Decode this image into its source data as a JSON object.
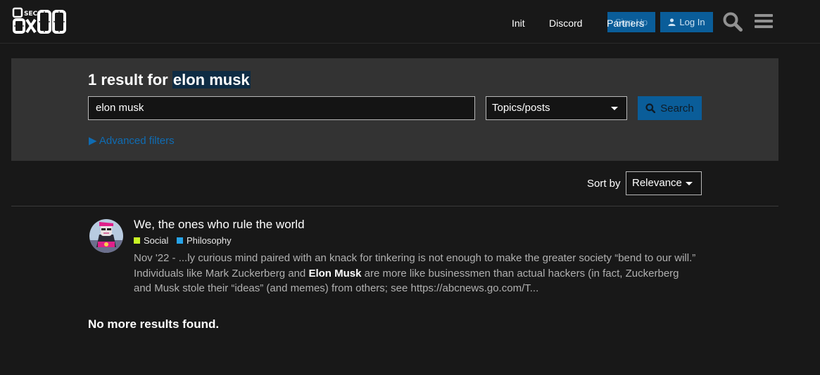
{
  "header": {
    "logo_text": "0x00 SEC",
    "nav": [
      {
        "label": "Init"
      },
      {
        "label": "Discord"
      },
      {
        "label": "Partners"
      }
    ],
    "signup_label": "Sign Up",
    "login_label": "Log In",
    "search_icon": "search-icon",
    "menu_icon": "hamburger-icon"
  },
  "search": {
    "count": "1",
    "heading_prefix": "result for",
    "term_display": "elon musk",
    "input_value": "elon musk",
    "type_selected": "Topics/posts",
    "search_button": "Search",
    "advanced_filters": "Advanced filters",
    "sort_label": "Sort by",
    "sort_selected": "Relevance"
  },
  "results": [
    {
      "title": "We, the ones who rule the world",
      "categories": [
        {
          "name": "Social",
          "color": "#c9f425"
        },
        {
          "name": "Philosophy",
          "color": "#27a3e8"
        }
      ],
      "blurb": {
        "line1": "Nov '22 - ...ly curious mind paired with an knack for tinkering is not enough to make the greater society “bend to our will.”",
        "line2_pre": "Individuals like Mark Zuckerberg and ",
        "line2_highlight": "Elon Musk",
        "line2_post": " are more like businessmen than actual hackers (in fact, Zuckerberg",
        "line3": "and Musk stole their “ideas” (and memes) from others; see https://abcnews.go.com/T..."
      }
    }
  ],
  "no_more": "No more results found.",
  "colors": {
    "background": "#181818",
    "panel": "#333333",
    "accent": "#0a5d99",
    "link": "#0f6cb3"
  }
}
